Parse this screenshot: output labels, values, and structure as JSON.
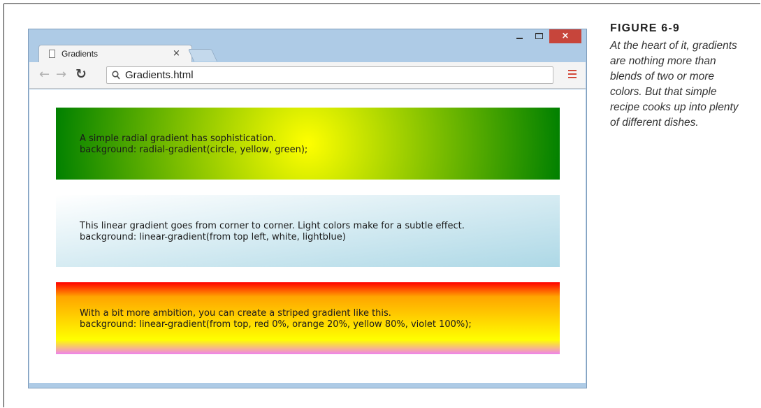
{
  "browser": {
    "tab_title": "Gradients",
    "tab_close": "×",
    "window_close": "×",
    "address": "Gradients.html"
  },
  "panels": [
    {
      "line1": "A simple radial gradient has sophistication.",
      "line2": "background: radial-gradient(circle, yellow, green);",
      "colors": [
        "yellow",
        "green"
      ]
    },
    {
      "line1": "This linear gradient goes from corner to corner. Light colors make for a subtle effect.",
      "line2": "background: linear-gradient(from top left, white, lightblue)",
      "colors": [
        "white",
        "lightblue"
      ]
    },
    {
      "line1": "With a bit more ambition, you can create a striped gradient like this.",
      "line2": "background: linear-gradient(from top, red 0%, orange 20%, yellow 80%, violet 100%);",
      "colors": [
        "red",
        "orange",
        "yellow",
        "violet"
      ]
    }
  ],
  "caption": {
    "label": "FIGURE 6-9",
    "lines": [
      "At the heart of it, gradients",
      "are nothing more than",
      "blends of two or more",
      "colors. But that simple",
      "recipe cooks up into plenty",
      "of different dishes."
    ]
  },
  "colors": {
    "window_chrome": "#aecbe6",
    "close_button": "#c7453b",
    "menu_icon": "#d24a3a"
  }
}
